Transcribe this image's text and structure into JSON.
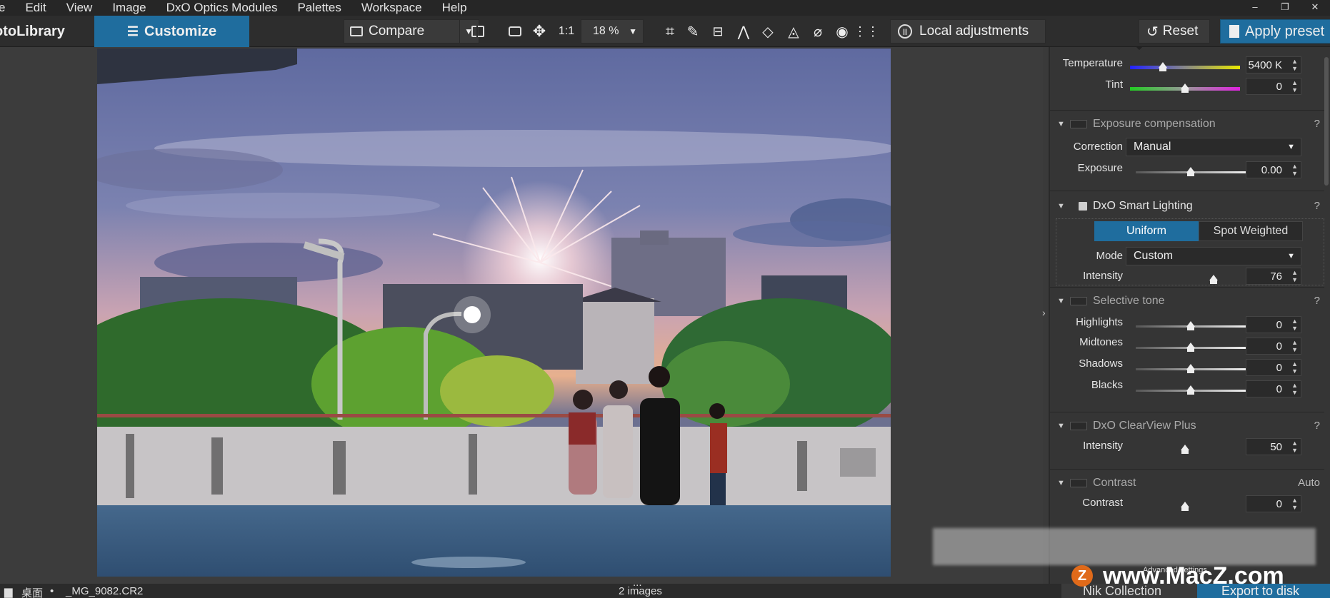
{
  "menu": [
    "e",
    "Edit",
    "View",
    "Image",
    "DxO Optics Modules",
    "Palettes",
    "Workspace",
    "Help"
  ],
  "window_controls": {
    "minimize": "–",
    "restore": "❐",
    "close": "✕"
  },
  "toolbar": {
    "photolibrary_tab": "otoLibrary",
    "customize_tab": "Customize",
    "compare_label": "Compare",
    "one_to_one": "1:1",
    "zoom_value": "18 %",
    "local_adjustments_label": "Local adjustments",
    "reset_label": "Reset",
    "apply_preset_label": "Apply preset"
  },
  "panel": {
    "white_balance": {
      "temperature_label": "Temperature",
      "temperature_value": "5400 K",
      "temperature_pos": 0.3,
      "tint_label": "Tint",
      "tint_value": "0",
      "tint_pos": 0.5
    },
    "exposure": {
      "title": "Exposure compensation",
      "correction_label": "Correction",
      "correction_value": "Manual",
      "exposure_label": "Exposure",
      "exposure_value": "0.00",
      "exposure_pos": 0.5,
      "help": "?"
    },
    "smart_lighting": {
      "title": "DxO Smart Lighting",
      "uniform_label": "Uniform",
      "spot_weighted_label": "Spot Weighted",
      "mode_label": "Mode",
      "mode_value": "Custom",
      "intensity_label": "Intensity",
      "intensity_value": "76",
      "intensity_pos": 0.76,
      "help": "?"
    },
    "selective_tone": {
      "title": "Selective tone",
      "rows": [
        {
          "label": "Highlights",
          "value": "0",
          "pos": 0.5
        },
        {
          "label": "Midtones",
          "value": "0",
          "pos": 0.5
        },
        {
          "label": "Shadows",
          "value": "0",
          "pos": 0.5
        },
        {
          "label": "Blacks",
          "value": "0",
          "pos": 0.5
        }
      ],
      "help": "?"
    },
    "clearview": {
      "title": "DxO ClearView Plus",
      "intensity_label": "Intensity",
      "intensity_value": "50",
      "intensity_pos": 0.5,
      "help": "?"
    },
    "contrast": {
      "title": "Contrast",
      "auto_label": "Auto",
      "contrast_label": "Contrast",
      "contrast_value": "0",
      "contrast_pos": 0.5,
      "advanced_label": "Advanced settings"
    }
  },
  "status": {
    "folder": "桌面",
    "filename": "_MG_9082.CR2",
    "image_count": "2 images",
    "grip": "...",
    "nik_collection_label": "Nik Collection",
    "export_label": "Export to disk"
  },
  "watermark": {
    "site": "www.MacZ.com",
    "logo_letter": "Z"
  },
  "colors": {
    "accent": "#1f6d9e",
    "panel_bg": "#353535",
    "toolbar_bg": "#2d2d2d"
  }
}
